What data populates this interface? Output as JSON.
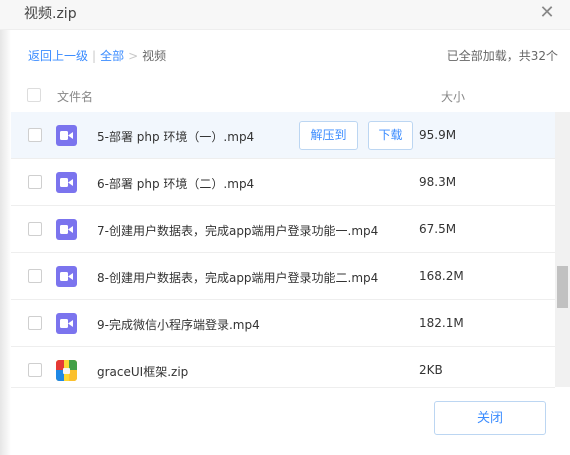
{
  "window": {
    "title": "视频.zip",
    "close_symbol": "✕"
  },
  "breadcrumb": {
    "back": "返回上一级",
    "separator": "|",
    "all": "全部",
    "arrow": ">",
    "current": "视频"
  },
  "load_status": "已全部加载，共32个",
  "header": {
    "name_label": "文件名",
    "size_label": "大小"
  },
  "row_actions": {
    "extract_label": "解压到",
    "download_label": "下载"
  },
  "files": [
    {
      "name": "5-部署 php 环境（一）.mp4",
      "size": "95.9M",
      "icon": "video-icon"
    },
    {
      "name": "6-部署 php 环境（二）.mp4",
      "size": "98.3M",
      "icon": "video-icon"
    },
    {
      "name": "7-创建用户数据表，完成app端用户登录功能一.mp4",
      "size": "67.5M",
      "icon": "video-icon"
    },
    {
      "name": "8-创建用户数据表，完成app端用户登录功能二.mp4",
      "size": "168.2M",
      "icon": "video-icon"
    },
    {
      "name": "9-完成微信小程序端登录.mp4",
      "size": "182.1M",
      "icon": "video-icon"
    },
    {
      "name": "graceUI框架.zip",
      "size": "2KB",
      "icon": "archive-icon"
    }
  ],
  "footer": {
    "close_label": "关闭"
  },
  "colors": {
    "accent": "#3b8cff",
    "video_icon": "#7b74ee",
    "row_hover": "#f2f7fd"
  }
}
